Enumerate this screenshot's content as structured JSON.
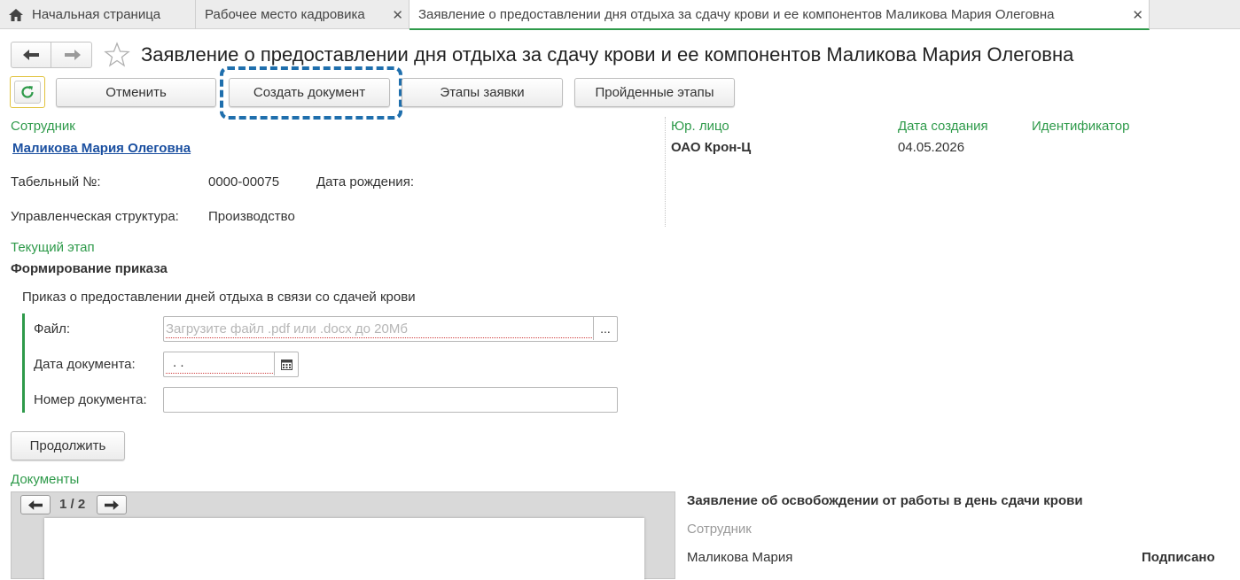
{
  "tabs": [
    {
      "label": "Начальная страница"
    },
    {
      "label": "Рабочее место кадровика",
      "close": "✕"
    },
    {
      "label": "Заявление о предоставлении дня отдыха за сдачу крови и ее компонентов Маликова Мария Олеговна",
      "close": "✕"
    }
  ],
  "header": {
    "title": "Заявление о предоставлении дня отдыха за сдачу крови и ее компонентов Маликова Мария Олеговна"
  },
  "toolbar": {
    "cancel": "Отменить",
    "create": "Создать документ",
    "stages": "Этапы заявки",
    "passed": "Пройденные этапы"
  },
  "employee": {
    "label": "Сотрудник",
    "name": "Маликова Мария Олеговна",
    "tab_label": "Табельный №:",
    "tab_value": "0000-00075",
    "birth_label": "Дата рождения:",
    "struct_label": "Управленческая структура:",
    "struct_value": "Производство"
  },
  "org": {
    "label": "Юр. лицо",
    "value": "ОАО Крон-Ц",
    "date_label": "Дата создания",
    "date_value": "04.05.2026",
    "id_label": "Идентификатор"
  },
  "stage": {
    "label": "Текущий этап",
    "value": "Формирование приказа",
    "subtitle": "Приказ о предоставлении дней отдыха в связи со сдачей крови",
    "file_label": "Файл:",
    "file_placeholder": "Загрузите файл .pdf или .docx до 20Мб",
    "file_btn": "...",
    "date_label": "Дата документа:",
    "date_value": " .  .",
    "number_label": "Номер документа:",
    "continue": "Продолжить"
  },
  "documents": {
    "label": "Документы",
    "page": "1 / 2",
    "doc_title": "Заявление об освобождении от работы в день сдачи крови",
    "emp_label": "Сотрудник",
    "emp_name": "Маликова Мария",
    "status": "Подписано"
  },
  "colors": {
    "accent_green": "#2e9a4a",
    "link_blue": "#1a4fa0",
    "highlight_dash": "#1f6fad"
  }
}
